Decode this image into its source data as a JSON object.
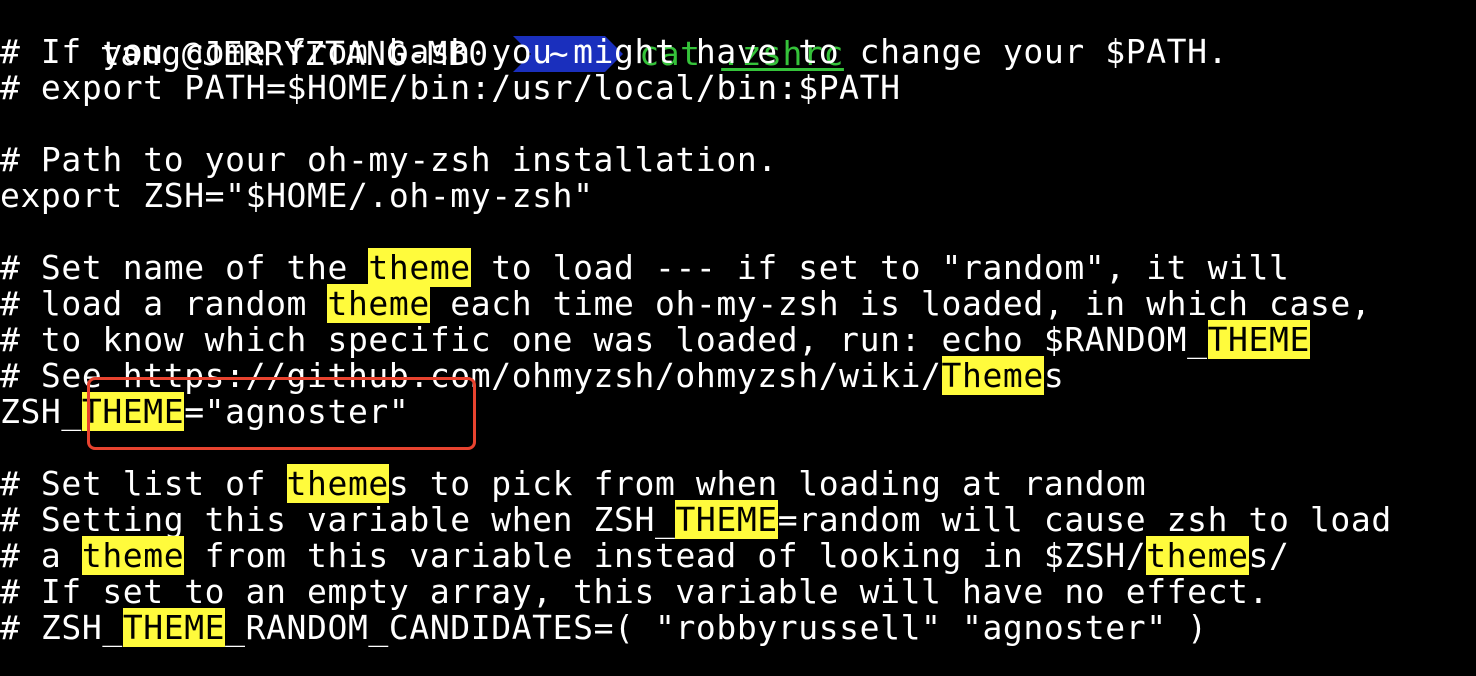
{
  "prompt": {
    "user_host": "tang@JERRYZTANG-MB0",
    "directory": "~",
    "command": "cat",
    "argument": ".zshrc",
    "dir_bg_color": "#1a2fbd",
    "command_color": "#35c23a"
  },
  "highlight_color": "#fffb3c",
  "annotation_color": "#e8432f",
  "lines": [
    [
      {
        "t": "# If you come from bash you might have to change your $PATH."
      }
    ],
    [
      {
        "t": "# export PATH=$HOME/bin:/usr/local/bin:$PATH"
      }
    ],
    [
      {
        "t": ""
      }
    ],
    [
      {
        "t": "# Path to your oh-my-zsh installation."
      }
    ],
    [
      {
        "t": "export ZSH=\"$HOME/.oh-my-zsh\""
      }
    ],
    [
      {
        "t": ""
      }
    ],
    [
      {
        "t": "# Set name of the "
      },
      {
        "t": "theme",
        "hl": true
      },
      {
        "t": " to load --- if set to \"random\", it will"
      }
    ],
    [
      {
        "t": "# load a random "
      },
      {
        "t": "theme",
        "hl": true
      },
      {
        "t": " each time oh-my-zsh is loaded, in which case,"
      }
    ],
    [
      {
        "t": "# to know which specific one was loaded, run: echo $RANDOM_"
      },
      {
        "t": "THEME",
        "hl": true
      }
    ],
    [
      {
        "t": "# See https://github.com/ohmyzsh/ohmyzsh/wiki/"
      },
      {
        "t": "Theme",
        "hl": true
      },
      {
        "t": "s"
      }
    ],
    [
      {
        "t": "ZSH_"
      },
      {
        "t": "THEME",
        "hl": true
      },
      {
        "t": "=\"agnoster\""
      }
    ],
    [
      {
        "t": ""
      }
    ],
    [
      {
        "t": "# Set list of "
      },
      {
        "t": "theme",
        "hl": true
      },
      {
        "t": "s to pick from when loading at random"
      }
    ],
    [
      {
        "t": "# Setting this variable when ZSH_"
      },
      {
        "t": "THEME",
        "hl": true
      },
      {
        "t": "=random will cause zsh to load"
      }
    ],
    [
      {
        "t": "# a "
      },
      {
        "t": "theme",
        "hl": true
      },
      {
        "t": " from this variable instead of looking in $ZSH/"
      },
      {
        "t": "theme",
        "hl": true
      },
      {
        "t": "s/"
      }
    ],
    [
      {
        "t": "# If set to an empty array, this variable will have no effect."
      }
    ],
    [
      {
        "t": "# ZSH_"
      },
      {
        "t": "THEME",
        "hl": true
      },
      {
        "t": "_RANDOM_CANDIDATES=( \"robbyrussell\" \"agnoster\" )"
      }
    ]
  ]
}
